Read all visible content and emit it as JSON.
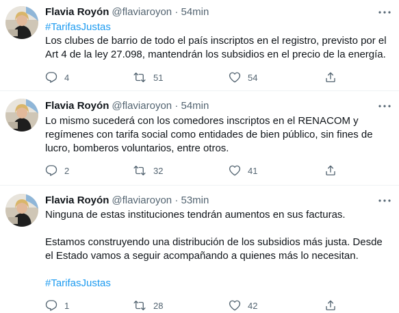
{
  "tweets": [
    {
      "author": "Flavia Royón",
      "handle": "@flaviaroyon",
      "time": "· 54min",
      "hashtag_top": "#TarifasJustas",
      "paragraphs": [
        "Los clubes de barrio de todo el país inscriptos en el registro, previsto por el Art 4 de la ley 27.098, mantendrán los subsidios en el precio de la energía."
      ],
      "hashtag_bottom": "",
      "replies": "4",
      "retweets": "51",
      "likes": "54"
    },
    {
      "author": "Flavia Royón",
      "handle": "@flaviaroyon",
      "time": "· 54min",
      "hashtag_top": "",
      "paragraphs": [
        "Lo mismo sucederá con los comedores inscriptos en el RENACOM y regímenes con tarifa social como entidades de bien público, sin fines de lucro, bomberos voluntarios, entre otros."
      ],
      "hashtag_bottom": "",
      "replies": "2",
      "retweets": "32",
      "likes": "41"
    },
    {
      "author": "Flavia Royón",
      "handle": "@flaviaroyon",
      "time": "· 53min",
      "hashtag_top": "",
      "paragraphs": [
        "Ninguna de estas instituciones tendrán aumentos en sus facturas.",
        "Estamos construyendo una distribución de los subsidios más justa. Desde el Estado vamos a seguir acompañando a quienes más lo necesitan."
      ],
      "hashtag_bottom": "#TarifasJustas",
      "replies": "1",
      "retweets": "28",
      "likes": "42"
    }
  ],
  "icons": {
    "reply": "reply-icon",
    "retweet": "retweet-icon",
    "like": "heart-icon",
    "share": "share-icon",
    "more": "more-icon"
  },
  "colors": {
    "link": "#1d9bf0",
    "secondary": "#536471",
    "text": "#0f1419",
    "divider": "#eff3f4"
  }
}
